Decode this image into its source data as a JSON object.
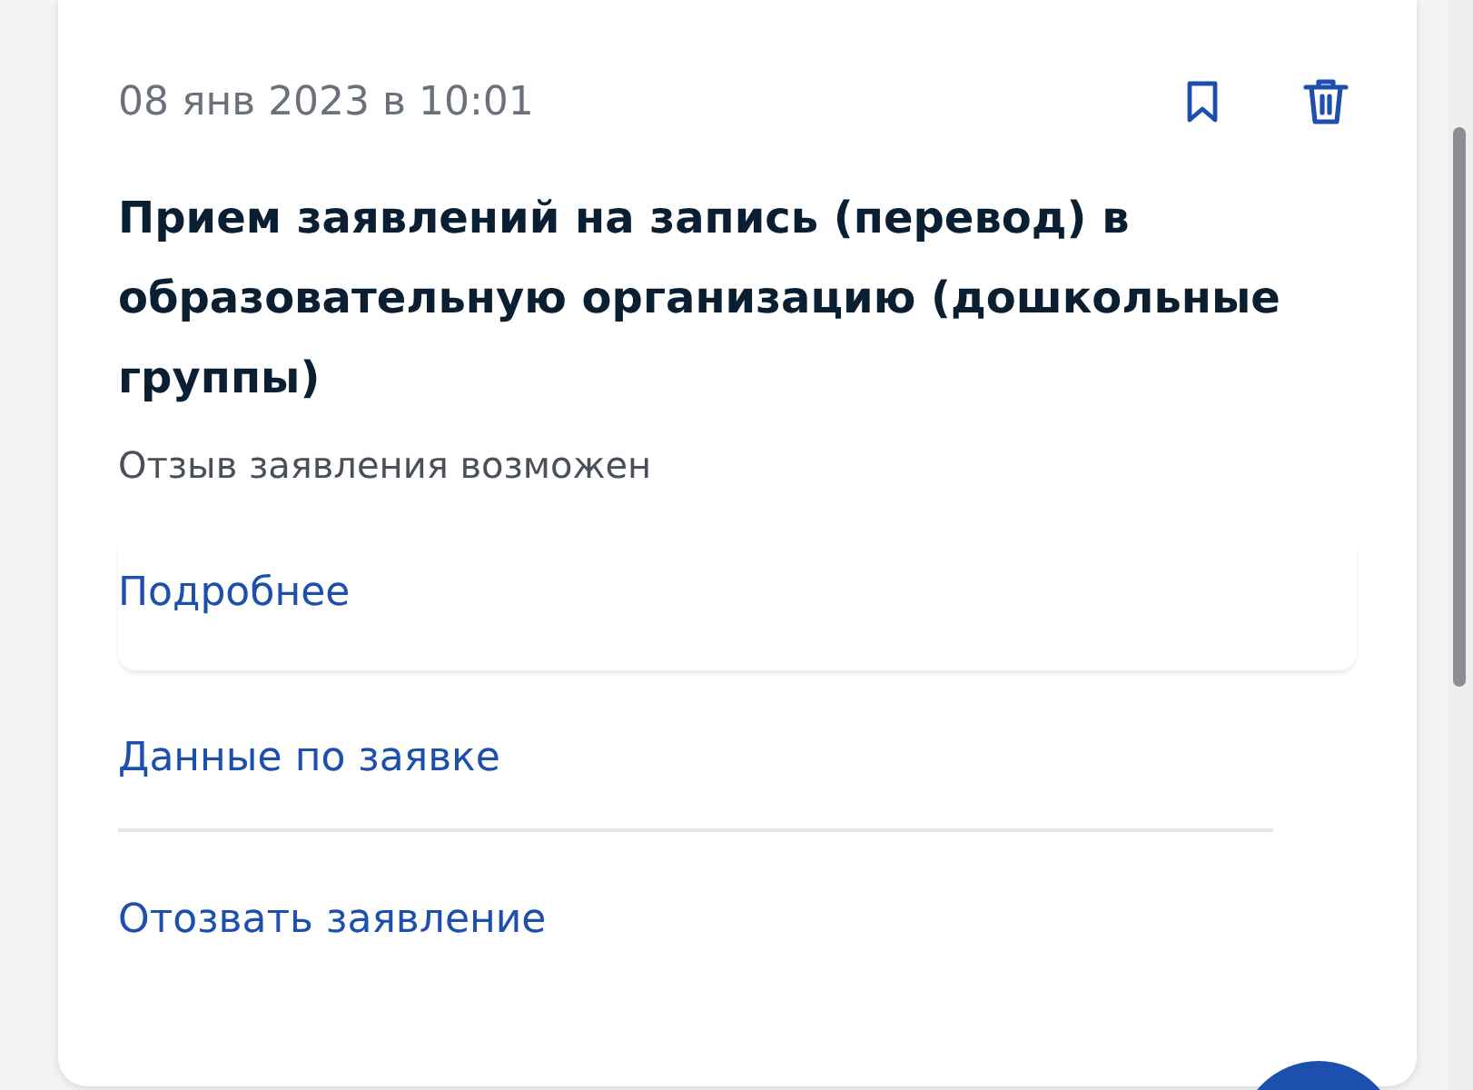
{
  "card": {
    "date": "08 янв 2023 в 10:01",
    "title": "Прием заявлений на запись (перевод) в образовательную организацию (дошкольные группы)",
    "status": "Отзыв заявления возможен",
    "links": [
      {
        "label": "Подробнее",
        "kind": "panel"
      },
      {
        "label": "Данные по заявке",
        "kind": "divided"
      },
      {
        "label": "Отозвать заявление",
        "kind": "plain"
      }
    ]
  }
}
